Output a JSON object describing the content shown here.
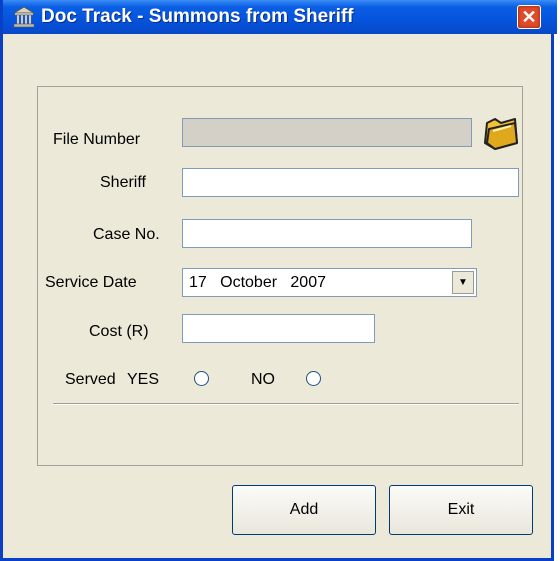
{
  "window": {
    "title": "Doc Track - Summons from Sheriff",
    "close_label": "✕",
    "title_icon": "building-icon"
  },
  "form": {
    "file_number": {
      "label": "File Number",
      "value": ""
    },
    "sheriff": {
      "label": "Sheriff",
      "value": ""
    },
    "case_no": {
      "label": "Case No.",
      "value": ""
    },
    "service_date": {
      "label": "Service Date",
      "day": "17",
      "month": "October",
      "year": "2007"
    },
    "cost": {
      "label": "Cost (R)",
      "value": ""
    },
    "served": {
      "label": "Served",
      "yes_label": "YES",
      "no_label": "NO",
      "selected": null
    }
  },
  "buttons": {
    "add": "Add",
    "exit": "Exit"
  },
  "colors": {
    "titlebar": "#0553dd",
    "window_bg": "#ece9d8",
    "close": "#e04b2a"
  }
}
